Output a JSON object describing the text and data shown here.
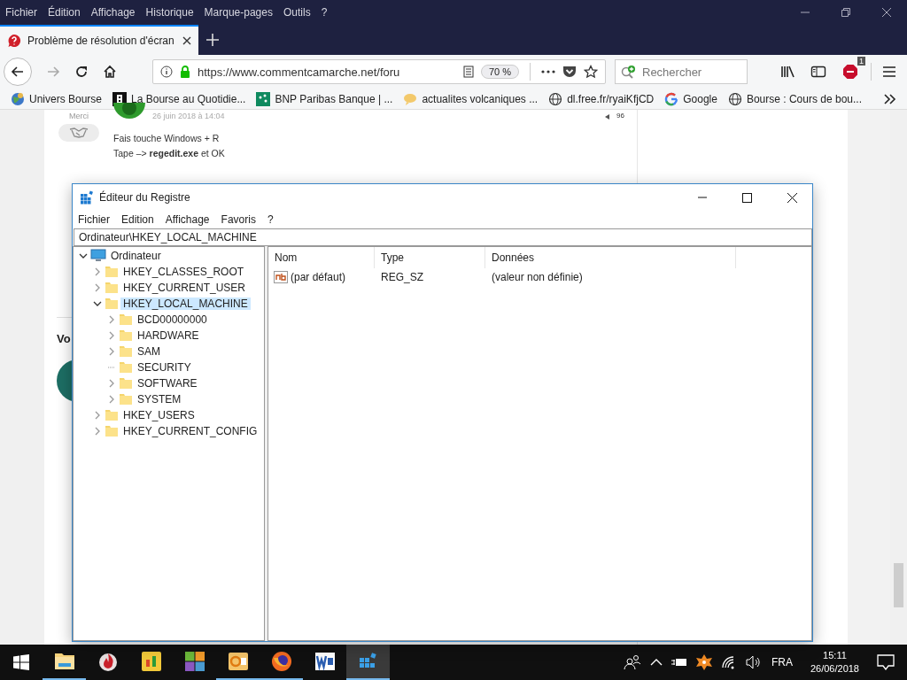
{
  "browser": {
    "menu": [
      "Fichier",
      "Édition",
      "Affichage",
      "Historique",
      "Marque-pages",
      "Outils",
      "?"
    ],
    "tab": {
      "title": "Problème de résolution d'écran"
    },
    "url": "https://www.commentcamarche.net/foru",
    "zoom": "70 %",
    "search": {
      "placeholder": "Rechercher"
    },
    "addon_badge": "1",
    "bookmarks": [
      {
        "label": "Univers Bourse",
        "kind": "earth"
      },
      {
        "label": "La Bourse au Quotidie...",
        "kind": "dark"
      },
      {
        "label": "BNP Paribas Banque | ...",
        "kind": "green"
      },
      {
        "label": "actualites volcaniques ...",
        "kind": "bubble"
      },
      {
        "label": "dl.free.fr/ryaiKfjCD",
        "kind": "globe"
      },
      {
        "label": "Google",
        "kind": "google"
      },
      {
        "label": "Bourse : Cours de bou...",
        "kind": "globe"
      }
    ]
  },
  "page": {
    "post": {
      "thanks": "Merci",
      "date": "26 juin 2018 à 14:04",
      "votes": "96",
      "lines": [
        "Fais touche Windows + R",
        "Tape –> **regedit.exe** et OK"
      ]
    },
    "section_heading": "Vo"
  },
  "regedit": {
    "title": "Éditeur du Registre",
    "menu": [
      "Fichier",
      "Edition",
      "Affichage",
      "Favoris",
      "?"
    ],
    "address": "Ordinateur\\HKEY_LOCAL_MACHINE",
    "tree": [
      {
        "label": "Ordinateur",
        "kind": "computer",
        "expandable": true,
        "expanded": true,
        "selected": false,
        "children": [
          {
            "label": "HKEY_CLASSES_ROOT",
            "kind": "folder",
            "expandable": true,
            "expanded": false,
            "selected": false
          },
          {
            "label": "HKEY_CURRENT_USER",
            "kind": "folder",
            "expandable": true,
            "expanded": false,
            "selected": false
          },
          {
            "label": "HKEY_LOCAL_MACHINE",
            "kind": "folder",
            "expandable": true,
            "expanded": true,
            "selected": true,
            "children": [
              {
                "label": "BCD00000000",
                "kind": "folder",
                "expandable": true,
                "expanded": false,
                "selected": false
              },
              {
                "label": "HARDWARE",
                "kind": "folder",
                "expandable": true,
                "expanded": false,
                "selected": false
              },
              {
                "label": "SAM",
                "kind": "folder",
                "expandable": true,
                "expanded": false,
                "selected": false
              },
              {
                "label": "SECURITY",
                "kind": "folder",
                "expandable": false,
                "selected": false
              },
              {
                "label": "SOFTWARE",
                "kind": "folder",
                "expandable": true,
                "expanded": false,
                "selected": false
              },
              {
                "label": "SYSTEM",
                "kind": "folder",
                "expandable": true,
                "expanded": false,
                "selected": false
              }
            ]
          },
          {
            "label": "HKEY_USERS",
            "kind": "folder",
            "expandable": true,
            "expanded": false,
            "selected": false
          },
          {
            "label": "HKEY_CURRENT_CONFIG",
            "kind": "folder",
            "expandable": true,
            "expanded": false,
            "selected": false
          }
        ]
      }
    ],
    "columns": [
      "Nom",
      "Type",
      "Données"
    ],
    "values": [
      {
        "name": "(par défaut)",
        "type": "REG_SZ",
        "data": "(valeur non définie)"
      }
    ]
  },
  "taskbar": {
    "apps": [
      {
        "kind": "explorer",
        "running": true,
        "selected": false
      },
      {
        "kind": "flame",
        "running": false,
        "selected": false
      },
      {
        "kind": "chart",
        "running": false,
        "selected": false
      },
      {
        "kind": "tiles",
        "running": false,
        "selected": false
      },
      {
        "kind": "outlook",
        "running": true,
        "selected": false
      },
      {
        "kind": "firefox",
        "running": true,
        "selected": false
      },
      {
        "kind": "word",
        "running": false,
        "selected": false
      },
      {
        "kind": "regedit",
        "running": true,
        "selected": true
      }
    ],
    "language": "FRA",
    "time": "15:11",
    "date": "26/06/2018"
  }
}
